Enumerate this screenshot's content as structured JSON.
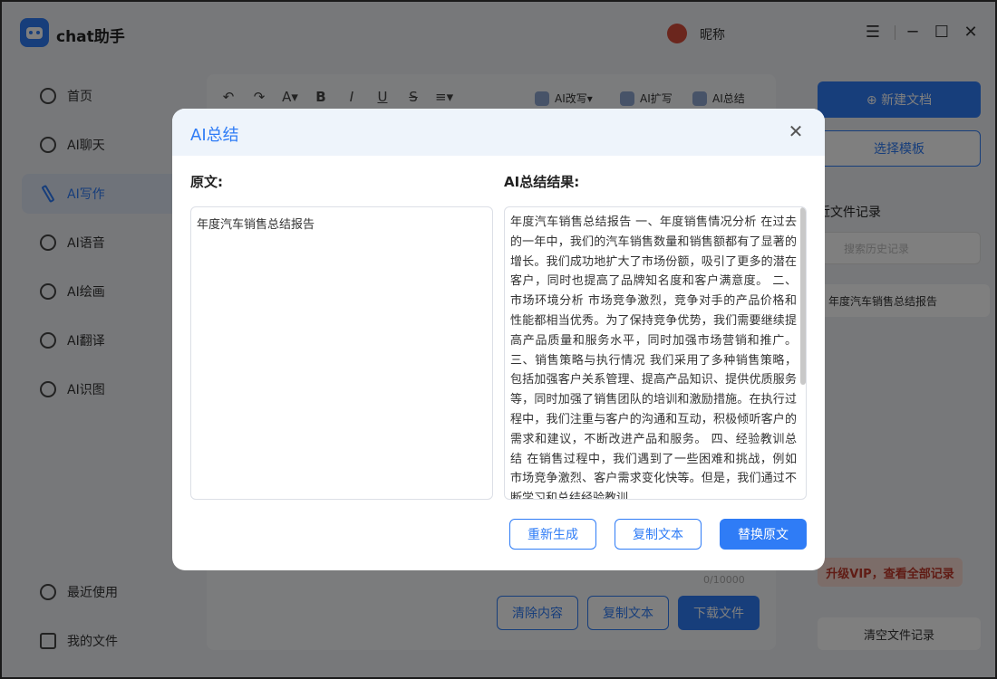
{
  "app": {
    "title": "chat助手",
    "nickname": "昵称"
  },
  "window": {
    "menu_icon": "☰",
    "minimize_icon": "─",
    "maximize_icon": "☐",
    "close_icon": "✕"
  },
  "sidebar": {
    "items": [
      {
        "label": "首页",
        "icon": "home-icon"
      },
      {
        "label": "AI聊天",
        "icon": "chat-icon"
      },
      {
        "label": "AI写作",
        "icon": "pen-icon",
        "active": true
      },
      {
        "label": "AI语音",
        "icon": "voice-icon"
      },
      {
        "label": "AI绘画",
        "icon": "palette-icon"
      },
      {
        "label": "AI翻译",
        "icon": "translate-icon"
      },
      {
        "label": "AI识图",
        "icon": "scan-icon"
      }
    ],
    "bottom": [
      {
        "label": "最近使用",
        "icon": "clock-icon"
      },
      {
        "label": "我的文件",
        "icon": "file-icon"
      }
    ]
  },
  "editor": {
    "toolbar": [
      "↶",
      "↷",
      "A▾",
      "B",
      "I",
      "U",
      "S",
      "≡▾"
    ],
    "ai_tools": [
      "AI改写▾",
      "AI扩写",
      "AI总结"
    ],
    "count": "0/10000",
    "buttons": {
      "clear": "清除内容",
      "copy": "复制文本",
      "download": "下载文件"
    }
  },
  "right_panel": {
    "new_doc": "⊕ 新建文档",
    "template": "选择模板",
    "recent_title": "近文件记录",
    "search_placeholder": "搜索历史记录",
    "recent_item": "年度汽车销售总结报告",
    "vip": "升级VIP，查看全部记录",
    "clear_records": "清空文件记录"
  },
  "modal": {
    "title": "AI总结",
    "original_label": "原文:",
    "result_label": "AI总结结果:",
    "original_text": "年度汽车销售总结报告",
    "result_text": "年度汽车销售总结报告 一、年度销售情况分析 在过去的一年中，我们的汽车销售数量和销售额都有了显著的增长。我们成功地扩大了市场份额，吸引了更多的潜在客户，同时也提高了品牌知名度和客户满意度。 二、市场环境分析 市场竞争激烈，竞争对手的产品价格和性能都相当优秀。为了保持竞争优势，我们需要继续提高产品质量和服务水平，同时加强市场营销和推广。 三、销售策略与执行情况 我们采用了多种销售策略，包括加强客户关系管理、提高产品知识、提供优质服务等，同时加强了销售团队的培训和激励措施。在执行过程中，我们注重与客户的沟通和互动，积极倾听客户的需求和建议，不断改进产品和服务。 四、经验教训总结 在销售过程中，我们遇到了一些困难和挑战，例如市场竞争激烈、客户需求变化快等。但是，我们通过不断学习和总结经验教训，",
    "buttons": {
      "regenerate": "重新生成",
      "copy": "复制文本",
      "replace": "替换原文"
    }
  },
  "colors": {
    "accent": "#2f7cf6",
    "vip_text": "#c0392b"
  }
}
